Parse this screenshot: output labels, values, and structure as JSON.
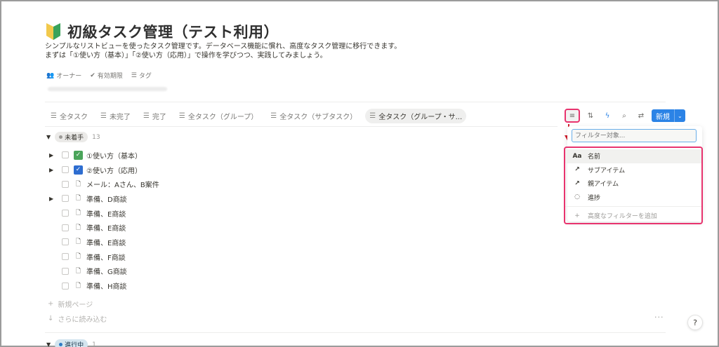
{
  "page": {
    "title": "初級タスク管理（テスト利用）",
    "description_line1": "シンプルなリストビューを使ったタスク管理です。データベース機能に慣れ、高度なタスク管理に移行できます。",
    "description_line2": "まずは「①使い方（基本）」「②使い方（応用）」で操作を学びつつ、実践してみましょう。"
  },
  "properties": [
    {
      "icon": "people-icon",
      "label": "オーナー"
    },
    {
      "icon": "check-circle-icon",
      "label": "有効期限"
    },
    {
      "icon": "list-icon",
      "label": "タグ"
    }
  ],
  "tabs": [
    {
      "label": "全タスク",
      "active": false
    },
    {
      "label": "未完了",
      "active": false
    },
    {
      "label": "完了",
      "active": false
    },
    {
      "label": "全タスク（グループ）",
      "active": false
    },
    {
      "label": "全タスク（サブタスク）",
      "active": false
    },
    {
      "label": "全タスク（グループ・サ...",
      "active": true
    }
  ],
  "toolbar": {
    "new_label": "新規"
  },
  "group1": {
    "status": "未着手",
    "count": "13",
    "color": "#9b9a97"
  },
  "rows": [
    {
      "name": "①使い方（基本）",
      "expand": true,
      "icon": "green-check-icon"
    },
    {
      "name": "②使い方（応用）",
      "expand": true,
      "icon": "blue-check-icon"
    },
    {
      "name": "メール：Aさん、B案件",
      "expand": false,
      "icon": "page-icon"
    },
    {
      "name": "準備、D商談",
      "expand": true,
      "icon": "page-icon"
    },
    {
      "name": "準備、E商談",
      "expand": false,
      "icon": "page-icon"
    },
    {
      "name": "準備、E商談",
      "expand": false,
      "icon": "page-icon"
    },
    {
      "name": "準備、E商談",
      "expand": false,
      "icon": "page-icon"
    },
    {
      "name": "準備、F商談",
      "expand": false,
      "icon": "page-icon"
    },
    {
      "name": "準備、G商談",
      "expand": false,
      "icon": "page-icon"
    },
    {
      "name": "準備、H商談",
      "expand": false,
      "icon": "page-icon"
    }
  ],
  "new_page_label": "新規ページ",
  "load_more_label": "さらに読み込む",
  "group2": {
    "status": "進行中",
    "count": "1",
    "color": "#2e7bc4"
  },
  "filter_menu": {
    "search_placeholder": "フィルター対象...",
    "options": [
      {
        "icon_text": "Aa",
        "label": "名前"
      },
      {
        "icon_text": "↗",
        "label": "サブアイテム"
      },
      {
        "icon_text": "↗",
        "label": "親アイテム"
      },
      {
        "icon_text": "◌",
        "label": "進捗"
      }
    ],
    "add_label": "高度なフィルターを追加"
  },
  "help_label": "?"
}
